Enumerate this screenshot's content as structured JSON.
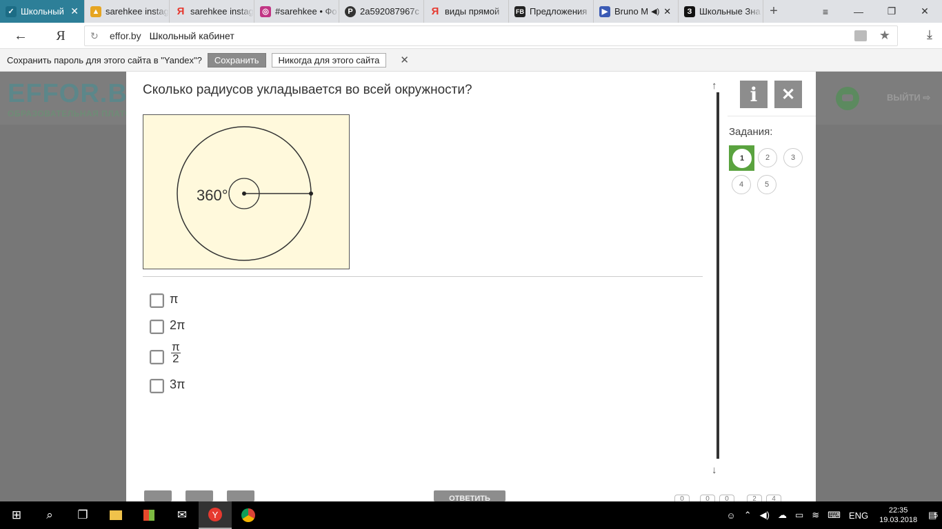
{
  "browser": {
    "tabs": [
      {
        "label": "Школьный",
        "active": true,
        "icon": "check-logo-icon",
        "icon_color": "#2d7f98"
      },
      {
        "label": "sarehkee instag",
        "icon": "image-thumb-icon",
        "icon_color": "#e6a522"
      },
      {
        "label": "sarehkee instag",
        "icon": "yandex-icon",
        "icon_color": "#e6392f"
      },
      {
        "label": "#sarehkee • Фо",
        "icon": "instagram-icon",
        "icon_color": "#c13584"
      },
      {
        "label": "2a592087967c",
        "icon": "pinterest-icon",
        "icon_color": "#333333"
      },
      {
        "label": "виды прямой",
        "icon": "yandex-icon",
        "icon_color": "#e6392f"
      },
      {
        "label": "Предложения",
        "icon": "fb-icon",
        "icon_color": "#222222"
      },
      {
        "label": "Bruno M",
        "icon": "video-icon",
        "icon_color": "#3b5bb5"
      },
      {
        "label": "Школьные Зна",
        "icon": "znanija-icon",
        "icon_color": "#111111"
      }
    ],
    "url_domain": "effor.by",
    "page_title": "Школьный кабинет"
  },
  "infobar": {
    "message": "Сохранить пароль для этого сайта в \"Yandex\"?",
    "save_label": "Сохранить",
    "never_label": "Никогда для этого сайта"
  },
  "site": {
    "logo_text": "EFFOR.B",
    "logo_sub": "ОБРАЗОВАТЕЛЬНАЯ ПЛАТФ",
    "exit_label": "ВЫЙТИ"
  },
  "quiz": {
    "question": "Сколько радиусов укладывается во всей окружности?",
    "figure": {
      "angle_label": "360°",
      "background": "#fff9dc"
    },
    "answers": [
      {
        "label": "π"
      },
      {
        "label": "2π"
      },
      {
        "numerator": "π",
        "denominator": "2"
      },
      {
        "label": "3π"
      }
    ],
    "tasks_title": "Задания:",
    "tasks": [
      "1",
      "2",
      "3",
      "4",
      "5"
    ],
    "current_task": "1",
    "task_accent": "#5aa33f",
    "submit_label": "ОТВЕТИТЬ",
    "pager": [
      "0",
      "0",
      "0",
      "2",
      "4"
    ]
  },
  "taskbar": {
    "language": "ENG",
    "time": "22:35",
    "date": "19.03.2018",
    "notifications": "5"
  }
}
